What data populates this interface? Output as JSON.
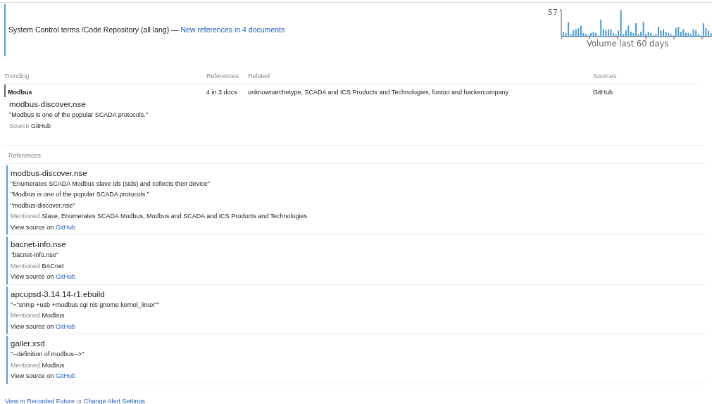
{
  "header": {
    "title": "System Control terms /Code Repository (all lang) —",
    "link": "New references in 4 documents"
  },
  "volume_chart": {
    "max_label": "57",
    "caption": "Volume last 60 days"
  },
  "trending": {
    "columns": [
      "Trending",
      "References",
      "Related",
      "Sources"
    ],
    "rows": [
      {
        "term": "Modbus",
        "references": "4 in 3 docs",
        "related": "unknownarchetype, SCADA and ICS Products and Technologies, funtoo and hackercompany",
        "sources": "GitHub"
      }
    ]
  },
  "highlight": {
    "title": "modbus-discover.nse",
    "quotes": [
      "\"Modbus is one of the popular SCADA protocols.\""
    ],
    "source_label": "Source",
    "source": "GitHub"
  },
  "references": {
    "label": "References",
    "items": [
      {
        "title": "modbus-discover.nse",
        "quotes": [
          "\"Enumerates SCADA Modbus slave ids (sids) and collects their device\"",
          "\"Modbus is one of the popular SCADA protocols.\"",
          "\"modbus-discover.nse\""
        ],
        "mentioned_label": "Mentioned",
        "mentioned": "Slave, Enumerates SCADA Modbus, Modbus and SCADA and ICS Products and Technologies",
        "view_source": "View source on",
        "link": "GitHub"
      },
      {
        "title": "bacnet-info.nse",
        "quotes": [
          "\"bacnet-info.nse\""
        ],
        "mentioned_label": "Mentioned",
        "mentioned": "BACnet",
        "view_source": "View source on",
        "link": "GitHub"
      },
      {
        "title": "apcupsd-3.14.14-r1.ebuild",
        "quotes": [
          "\"=\"snmp +usb +modbus cgi nls gnome kernel_linux\"\""
        ],
        "mentioned_label": "Mentioned",
        "mentioned": "Modbus",
        "view_source": "View source on",
        "link": "GitHub"
      },
      {
        "title": "galler.xsd",
        "quotes": [
          "\"--definition of modbus-->\""
        ],
        "mentioned_label": "Mentioned",
        "mentioned": "Modbus",
        "view_source": "View source on",
        "link": "GitHub"
      }
    ]
  },
  "footer": {
    "link_1": "View in Recorded Future",
    "joiner": "or",
    "link_2": "Change Alert Settings"
  }
}
